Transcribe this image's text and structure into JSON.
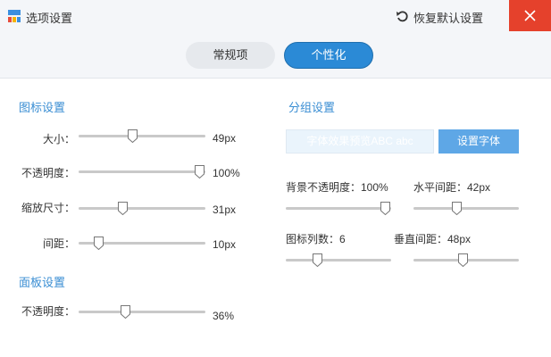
{
  "window": {
    "title": "选项设置",
    "restore_label": "恢复默认设置",
    "close_color": "#e5412c"
  },
  "tabs": [
    {
      "label": "常规项",
      "active": false
    },
    {
      "label": "个性化",
      "active": true
    }
  ],
  "icon_settings": {
    "title": "图标设置",
    "size": {
      "label": "大小：",
      "value": "49px",
      "level": 0.42
    },
    "opacity": {
      "label": "不透明度：",
      "value": "100%",
      "level": 1.0
    },
    "scale": {
      "label": "缩放尺寸：",
      "value": "31px",
      "level": 0.34
    },
    "spacing": {
      "label": "间距：",
      "value": "10px",
      "level": 0.13
    }
  },
  "panel_settings": {
    "title": "面板设置",
    "opacity": {
      "label": "不透明度：",
      "value": "36%",
      "level": 0.36
    }
  },
  "group_settings": {
    "title": "分组设置",
    "font_preview": "字体效果预览ABC abc",
    "set_font_label": "设置字体",
    "bg_opacity": {
      "label": "背景不透明度：100%",
      "level": 1.0
    },
    "h_spacing": {
      "label": "水平间距：42px",
      "level": 0.41
    },
    "columns": {
      "label": "图标列数：6",
      "level": 0.28
    },
    "v_spacing": {
      "label": "垂直间距：48px",
      "level": 0.47
    }
  },
  "accent_color": "#2b8ad6"
}
